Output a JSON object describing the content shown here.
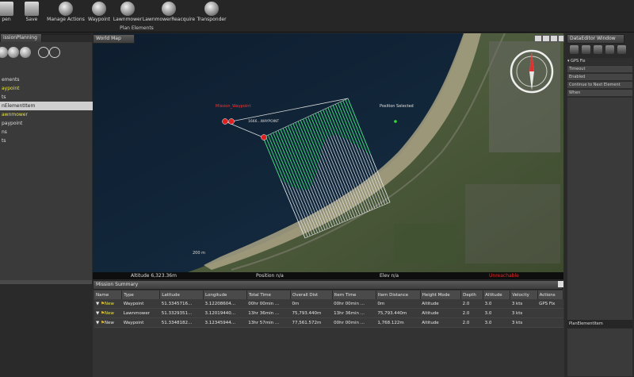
{
  "toolbar": {
    "buttons": [
      {
        "label": "pen",
        "icon": "open-icon"
      },
      {
        "label": "Save",
        "icon": "save-icon"
      },
      {
        "label": "Manage Actions",
        "icon": "manage-actions-icon"
      },
      {
        "label": "Waypoint",
        "icon": "waypoint-icon"
      },
      {
        "label": "Lawnmower",
        "icon": "lawnmower-icon"
      },
      {
        "label": "LawnmowerReacquire",
        "icon": "lawnmower-reacquire-icon"
      },
      {
        "label": "Transponder",
        "icon": "transponder-icon"
      }
    ],
    "group_label": "Plan Elements"
  },
  "left_panel": {
    "tab_title": "issionPlanning",
    "items": [
      {
        "label": "ements",
        "color": "normal"
      },
      {
        "label": "aypoint",
        "color": "yellow"
      },
      {
        "label": "ts",
        "color": "normal"
      },
      {
        "label": "nElementItem",
        "color": "selected"
      },
      {
        "label": "awnmower",
        "color": "yellow"
      },
      {
        "label": "paypoint",
        "color": "normal"
      },
      {
        "label": "ns",
        "color": "normal"
      },
      {
        "label": "ts",
        "color": "normal"
      }
    ]
  },
  "map": {
    "tab_title": "World Map",
    "route_label": "Mission_Waypoint",
    "leg_label": "1666...WAYPOINT",
    "marker_label": "Position Selected",
    "scale_label": "200 m",
    "status": {
      "altitude": "Altitude 6,323.36m",
      "position": "Position n/a",
      "elevation": "Elev n/a",
      "warning": "Unreachable"
    }
  },
  "summary": {
    "title": "Mission Summary",
    "columns": [
      "Name",
      "Type",
      "Latitude",
      "Longitude",
      "Total Time",
      "Overall Dist",
      "Item Time",
      "Item Distance",
      "Height Mode",
      "Depth",
      "Altitude",
      "Velocity",
      "Actions"
    ],
    "rows": [
      {
        "name": "New",
        "type": "Waypoint",
        "lat": "51.3345716...",
        "lon": "3.12208604...",
        "total_time": "00hr 00min ...",
        "overall_dist": "0m",
        "item_time": "00hr 00min ...",
        "item_dist": "0m",
        "height_mode": "Altitude",
        "depth": "2.0",
        "altitude": "3.0",
        "velocity": "3 kts",
        "actions": "GPS Fix"
      },
      {
        "name": "New",
        "type": "Lawnmower",
        "lat": "51.3329351...",
        "lon": "3.12019440...",
        "total_time": "13hr 36min ...",
        "overall_dist": "75,793.440m",
        "item_time": "13hr 36min ...",
        "item_dist": "75,793.440m",
        "height_mode": "Altitude",
        "depth": "2.0",
        "altitude": "3.0",
        "velocity": "3 kts",
        "actions": ""
      },
      {
        "name": "New",
        "type": "Waypoint",
        "lat": "51.3348182...",
        "lon": "3.12345944...",
        "total_time": "13hr 57min ...",
        "overall_dist": "77,561.572m",
        "item_time": "00hr 00min ...",
        "item_dist": "1,768.122m",
        "height_mode": "Altitude",
        "depth": "2.0",
        "altitude": "3.0",
        "velocity": "3 kts",
        "actions": ""
      }
    ]
  },
  "right_panel": {
    "title": "DataEditor Window",
    "item_title": "GPS Fix",
    "rows": [
      "Timeout",
      "Enabled",
      "Continue to Next Element",
      "When"
    ],
    "bottom_title": "PlanElementItem"
  }
}
